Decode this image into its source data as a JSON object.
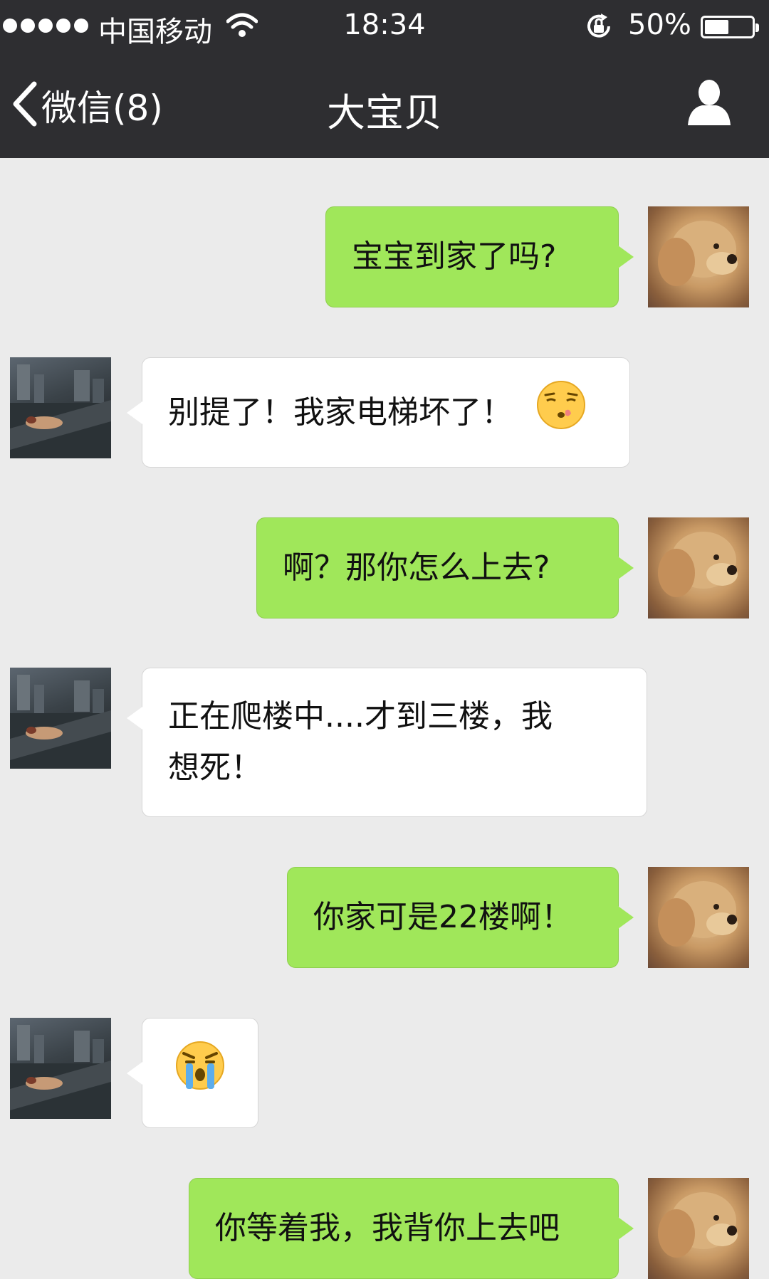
{
  "status_bar": {
    "carrier": "中国移动",
    "time": "18:34",
    "battery": "50%",
    "battery_level": 0.5,
    "signal_bars": 5
  },
  "nav": {
    "back_label": "微信(8)",
    "title": "大宝贝",
    "back_icon": "chevron-left-icon",
    "profile_icon": "person-icon"
  },
  "colors": {
    "bar_background": "#2e2e31",
    "chat_background": "#ebebeb",
    "outgoing_bubble": "#a0e75a",
    "incoming_bubble": "#ffffff"
  },
  "messages": [
    {
      "direction": "outgoing",
      "text": "宝宝到家了吗?"
    },
    {
      "direction": "incoming",
      "text": "别提了！我家电梯坏了！",
      "emoji": "sleepy-sad-face-icon"
    },
    {
      "direction": "outgoing",
      "text": "啊？那你怎么上去?"
    },
    {
      "direction": "incoming",
      "line1": "正在爬楼中....才到三楼，我",
      "line2": "想死！"
    },
    {
      "direction": "outgoing",
      "text": "你家可是22楼啊！"
    },
    {
      "direction": "incoming",
      "emoji": "crying-face-icon"
    },
    {
      "direction": "outgoing",
      "text": "你等着我，我背你上去吧"
    }
  ]
}
